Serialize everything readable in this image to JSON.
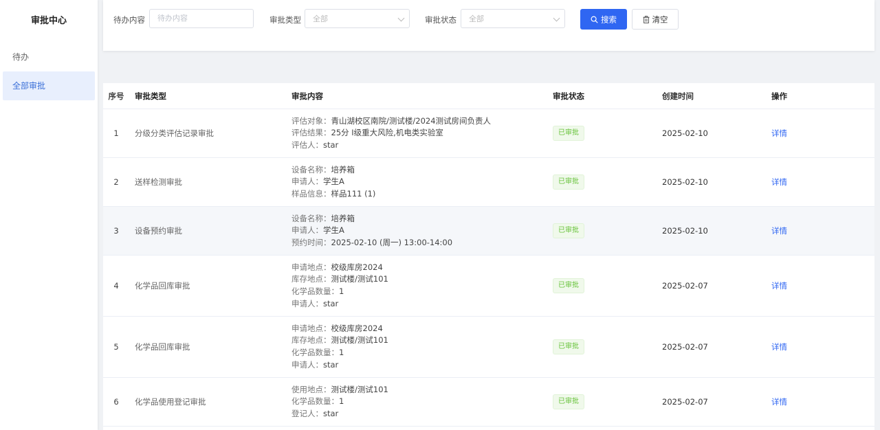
{
  "sidebar": {
    "title": "审批中心",
    "items": [
      {
        "label": "待办",
        "active": false
      },
      {
        "label": "全部审批",
        "active": true
      }
    ]
  },
  "filters": {
    "content_label": "待办内容",
    "content_placeholder": "待办内容",
    "type_label": "审批类型",
    "type_value": "全部",
    "status_label": "审批状态",
    "status_value": "全部",
    "search_button": "搜索",
    "clear_button": "清空"
  },
  "colors": {
    "primary": "#2f66f2",
    "badge_bg": "#f0f9eb",
    "badge_text": "#67c23a",
    "sidebar_active_bg": "#e8effd"
  },
  "table": {
    "headers": [
      "序号",
      "审批类型",
      "审批内容",
      "审批状态",
      "创建时间",
      "操作"
    ],
    "rows": [
      {
        "index": "1",
        "type": "分级分类评估记录审批",
        "content": [
          {
            "k": "评估对象：",
            "v": "青山湖校区南院/测试楼/2024测试房间负责人"
          },
          {
            "k": "评估结果：",
            "v": "25分 Ⅰ级重大风险,机电类实验室"
          },
          {
            "k": "评估人：",
            "v": "star"
          }
        ],
        "status": "已审批",
        "time": "2025-02-10",
        "action": "详情"
      },
      {
        "index": "2",
        "type": "送样检测审批",
        "content": [
          {
            "k": "设备名称：",
            "v": "培养箱"
          },
          {
            "k": "申请人：",
            "v": "学生A"
          },
          {
            "k": "样品信息：",
            "v": "样品111 (1)"
          }
        ],
        "status": "已审批",
        "time": "2025-02-10",
        "action": "详情"
      },
      {
        "index": "3",
        "type": "设备预约审批",
        "content": [
          {
            "k": "设备名称：",
            "v": "培养箱"
          },
          {
            "k": "申请人：",
            "v": "学生A"
          },
          {
            "k": "预约时间：",
            "v": "2025-02-10 (周一) 13:00-14:00"
          }
        ],
        "status": "已审批",
        "time": "2025-02-10",
        "action": "详情"
      },
      {
        "index": "4",
        "type": "化学品回库审批",
        "content": [
          {
            "k": "申请地点：",
            "v": "校级库房2024"
          },
          {
            "k": "库存地点：",
            "v": "测试楼/测试101"
          },
          {
            "k": "化学品数量：",
            "v": "1"
          },
          {
            "k": "申请人：",
            "v": "star"
          }
        ],
        "status": "已审批",
        "time": "2025-02-07",
        "action": "详情"
      },
      {
        "index": "5",
        "type": "化学品回库审批",
        "content": [
          {
            "k": "申请地点：",
            "v": "校级库房2024"
          },
          {
            "k": "库存地点：",
            "v": "测试楼/测试101"
          },
          {
            "k": "化学品数量：",
            "v": "1"
          },
          {
            "k": "申请人：",
            "v": "star"
          }
        ],
        "status": "已审批",
        "time": "2025-02-07",
        "action": "详情"
      },
      {
        "index": "6",
        "type": "化学品使用登记审批",
        "content": [
          {
            "k": "使用地点：",
            "v": "测试楼/测试101"
          },
          {
            "k": "化学品数量：",
            "v": "1"
          },
          {
            "k": "登记人：",
            "v": "star"
          }
        ],
        "status": "已审批",
        "time": "2025-02-07",
        "action": "详情"
      }
    ]
  }
}
